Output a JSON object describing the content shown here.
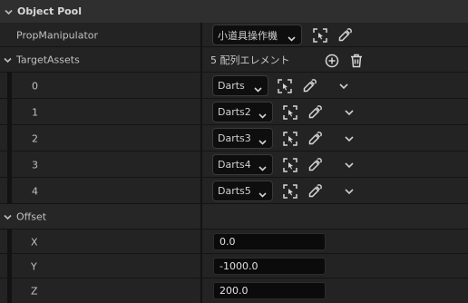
{
  "object_pool": {
    "title": "Object Pool",
    "prop_manipulator": {
      "label": "PropManipulator",
      "value": "小道具操作機"
    },
    "target_assets": {
      "label": "TargetAssets",
      "count_text": "5 配列エレメント",
      "items": [
        {
          "index": "0",
          "value": "Darts"
        },
        {
          "index": "1",
          "value": "Darts2"
        },
        {
          "index": "2",
          "value": "Darts3"
        },
        {
          "index": "3",
          "value": "Darts4"
        },
        {
          "index": "4",
          "value": "Darts5"
        }
      ]
    }
  },
  "offset": {
    "title": "Offset",
    "x": {
      "label": "X",
      "value": "0.0"
    },
    "y": {
      "label": "Y",
      "value": "-1000.0"
    },
    "z": {
      "label": "Z",
      "value": "200.0"
    }
  },
  "colors": {
    "background": "#1a1a1a",
    "row": "#232323",
    "header": "#2f2f2f",
    "input": "#0b0b0b"
  },
  "icons": {
    "browse": "browse-icon",
    "picker": "eyedropper-icon",
    "add": "add-element-icon",
    "delete": "trash-icon",
    "expand": "chevron-down-icon"
  }
}
